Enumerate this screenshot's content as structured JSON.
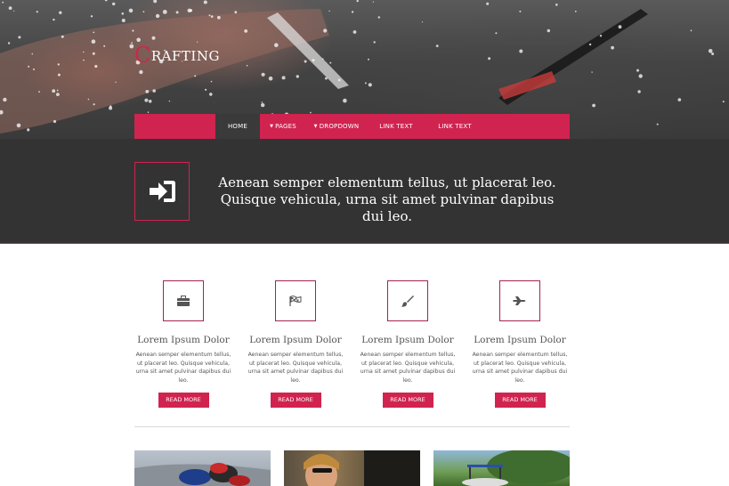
{
  "brand": {
    "logo_initial": "C",
    "logo_rest": "RAFTING",
    "accent_color": "#d1234f",
    "banner_color": "#333333"
  },
  "nav": {
    "items": [
      {
        "label": "HOME",
        "active": true,
        "dropdown": false
      },
      {
        "label": "PAGES",
        "active": false,
        "dropdown": true
      },
      {
        "label": "DROPDOWN",
        "active": false,
        "dropdown": true
      },
      {
        "label": "LINK TEXT",
        "active": false,
        "dropdown": false
      },
      {
        "label": "LINK TEXT",
        "active": false,
        "dropdown": false
      }
    ]
  },
  "banner": {
    "icon": "sign-in-icon",
    "text": "Aenean semper elementum tellus, ut placerat leo. Quisque vehicula, urna sit amet pulvinar dapibus dui leo."
  },
  "features": [
    {
      "icon": "briefcase-icon",
      "title": "Lorem Ipsum Dolor",
      "text": "Aenean semper elementum tellus, ut placerat leo. Quisque vehicula, urna sit amet pulvinar dapibus dui leo.",
      "button": "READ MORE"
    },
    {
      "icon": "flag-icon",
      "title": "Lorem Ipsum Dolor",
      "text": "Aenean semper elementum tellus, ut placerat leo. Quisque vehicula, urna sit amet pulvinar dapibus dui leo.",
      "button": "READ MORE"
    },
    {
      "icon": "brush-icon",
      "title": "Lorem Ipsum Dolor",
      "text": "Aenean semper elementum tellus, ut placerat leo. Quisque vehicula, urna sit amet pulvinar dapibus dui leo.",
      "button": "READ MORE"
    },
    {
      "icon": "fighter-jet-icon",
      "title": "Lorem Ipsum Dolor",
      "text": "Aenean semper elementum tellus, ut placerat leo. Quisque vehicula, urna sit amet pulvinar dapibus dui leo.",
      "button": "READ MORE"
    }
  ]
}
